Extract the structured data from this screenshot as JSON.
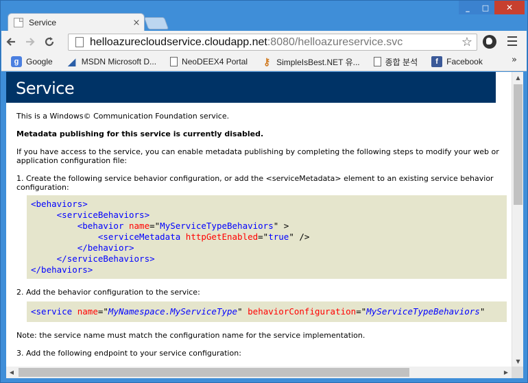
{
  "browser": {
    "tab_title": "Service",
    "tab_close": "×",
    "window_buttons": {
      "minimize": "_",
      "maximize": "□",
      "close": "✕"
    },
    "url_host": "helloazurecloudservice.cloudapp.net",
    "url_rest": ":8080/helloazureservice.svc",
    "bookmarks": [
      {
        "label": "Google",
        "icon": "google-icon"
      },
      {
        "label": "MSDN Microsoft D...",
        "icon": "msdn-icon"
      },
      {
        "label": "NeoDEEX4 Portal",
        "icon": "page-icon"
      },
      {
        "label": "SimpleIsBest.NET 유...",
        "icon": "key-icon"
      },
      {
        "label": "종합 분석",
        "icon": "page-icon"
      },
      {
        "label": "Facebook",
        "icon": "facebook-icon"
      }
    ],
    "bookmarks_more": "»"
  },
  "page": {
    "heading": "Service",
    "intro": "This is a Windows© Communication Foundation service.",
    "metadata_disabled": "Metadata publishing for this service is currently disabled.",
    "access_note": "If you have access to the service, you can enable metadata publishing by completing the following steps to modify your web or application configuration file:",
    "step1": "1. Create the following service behavior configuration, or add the <serviceMetadata> element to an existing service behavior configuration:",
    "step2": "2. Add the behavior configuration to the service:",
    "note": "Note: the service name must match the configuration name for the service implementation.",
    "step3": "3. Add the following endpoint to your service configuration:",
    "code1": {
      "l1": "<behaviors>",
      "l2": "<serviceBehaviors>",
      "l3_tag": "<behavior",
      "l3_attr": "name",
      "l3_eq": "=\"",
      "l3_val": "MyServiceTypeBehaviors",
      "l3_end": "\" >",
      "l4_tag": "<serviceMetadata",
      "l4_attr": "httpGetEnabled",
      "l4_eq": "=\"",
      "l4_val": "true",
      "l4_end": "\" />",
      "l5": "</behavior>",
      "l6": "</serviceBehaviors>",
      "l7": "</behaviors>"
    },
    "code2": {
      "tag": "<service",
      "attr1": "name",
      "val1": "MyNamespace.MyServiceType",
      "attr2": "behaviorConfiguration",
      "val2": "MyServiceTypeBehaviors"
    }
  }
}
